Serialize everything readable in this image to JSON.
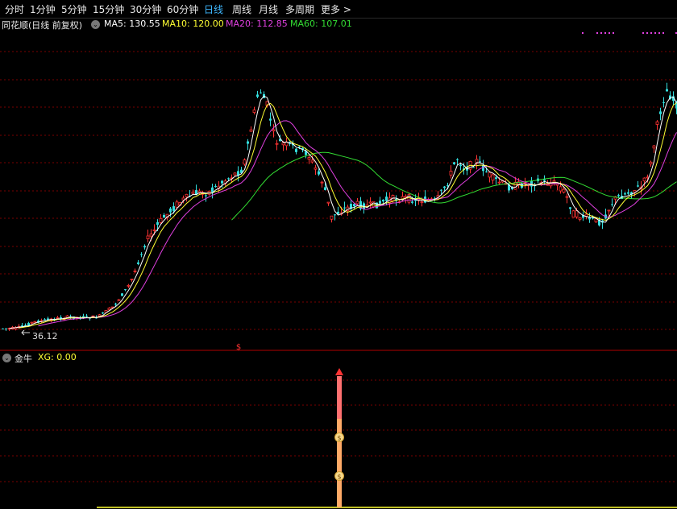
{
  "toolbar": {
    "tabs": [
      {
        "label": "分时"
      },
      {
        "label": "1分钟"
      },
      {
        "label": "5分钟"
      },
      {
        "label": "15分钟"
      },
      {
        "label": "30分钟"
      },
      {
        "label": "60分钟"
      },
      {
        "label": "日线"
      },
      {
        "label": "周线"
      },
      {
        "label": "月线"
      },
      {
        "label": "多周期"
      },
      {
        "label": "更多 >"
      }
    ],
    "active_tab": "日线"
  },
  "main_panel": {
    "title": "同花顺(日线 前复权)",
    "ma5_label": "MA5: 130.55",
    "ma10_label": "MA10: 120.00",
    "ma20_label": "MA20: 112.85",
    "ma60_label": "MA60: 107.01",
    "low_price_label": "36.12",
    "colors": {
      "ma5": "#ffffff",
      "ma10": "#ffff33",
      "ma20": "#e040e0",
      "ma60": "#33dd33",
      "up": "#ff3333",
      "down": "#33dddd"
    }
  },
  "sub_panel": {
    "title": "金牛",
    "xg_label": "XG: 0.00",
    "signal_icon": "money-bag-icon"
  }
}
